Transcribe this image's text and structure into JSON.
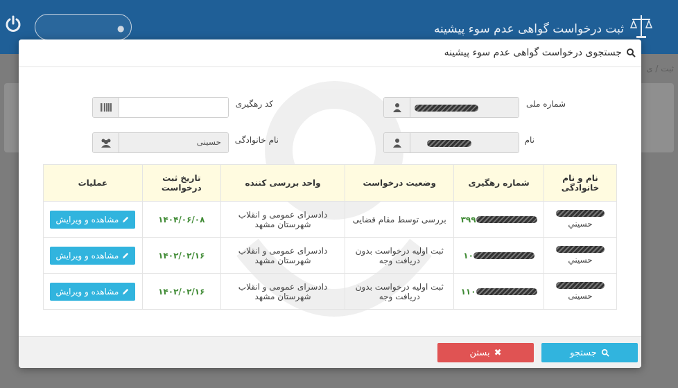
{
  "app": {
    "title": "ثبت درخواست گواهی عدم سوء پیشینه",
    "breadcrumb": "ثبت / ی"
  },
  "modal": {
    "title": "جستجوی درخواست گواهی عدم سوء پیشینه"
  },
  "form": {
    "national_id": {
      "label": "شماره ملی",
      "value": ""
    },
    "tracking_code": {
      "label": "کد رهگیری",
      "value": ""
    },
    "first_name": {
      "label": "نام",
      "value": ""
    },
    "last_name": {
      "label": "نام خانوادگی",
      "value": "حسینی"
    }
  },
  "table": {
    "headers": {
      "name": "نام و نام خانوادگی",
      "tracking": "شماره رهگیری",
      "status": "وضعیت درخواست",
      "unit": "واحد بررسی کننده",
      "date": "تاریخ ثبت درخواست",
      "actions": "عملیات"
    },
    "rows": [
      {
        "name": "حسيني",
        "tracking_suffix": "۳۹۹",
        "status": "بررسی توسط مقام قضایی",
        "unit": "دادسرای عمومی و انقلاب شهرستان مشهد",
        "date": "۱۴۰۴/۰۶/۰۸",
        "action": "مشاهده و ویرایش"
      },
      {
        "name": "حسيني",
        "tracking_suffix": "۱۰",
        "status": "ثبت اولیه درخواست بدون دریافت وجه",
        "unit": "دادسرای عمومی و انقلاب شهرستان مشهد",
        "date": "۱۴۰۲/۰۲/۱۶",
        "action": "مشاهده و ویرایش"
      },
      {
        "name": "حسینی",
        "tracking_suffix": "۱۱۰",
        "status": "ثبت اولیه درخواست بدون دریافت وجه",
        "unit": "دادسرای عمومی و انقلاب شهرستان مشهد",
        "date": "۱۴۰۲/۰۲/۱۶",
        "action": "مشاهده و ویرایش"
      }
    ]
  },
  "footer": {
    "search_label": "جستجو",
    "close_label": "بستن"
  },
  "colors": {
    "primary": "#31b4de",
    "danger": "#e05353",
    "header_bg": "#1f5f97",
    "date_green": "#3f8a34",
    "table_header_bg": "#fffbe0"
  },
  "icons": [
    "power-icon",
    "user-icon",
    "scales-logo-icon",
    "search-icon",
    "barcode-icon",
    "group-icon",
    "pencil-icon",
    "close-x-icon"
  ]
}
